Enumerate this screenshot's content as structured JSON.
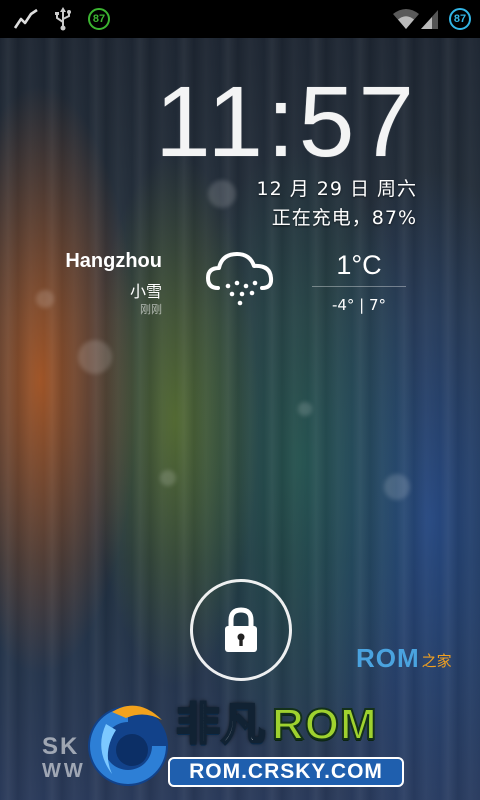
{
  "status_bar": {
    "left_icons": [
      "activity-graph-icon",
      "usb-icon",
      "battery-ring-icon"
    ],
    "left_battery_level": "87",
    "right_icons": [
      "wifi-icon",
      "signal-icon",
      "battery-ring-icon"
    ],
    "right_battery_level": "87",
    "colors": {
      "left_battery": "#3cb531",
      "right_battery": "#33b5e5"
    }
  },
  "lockscreen": {
    "time": "11:57",
    "date": "12 月 29 日 周六",
    "charging": "正在充电，87%"
  },
  "weather": {
    "city": "Hangzhou",
    "condition": "小雪",
    "updated": "刚刚",
    "icon": "snow-cloud-icon",
    "temperature": "1°C",
    "range": "-4° | 7°"
  },
  "unlock": {
    "icon": "lock-icon"
  },
  "watermarks": {
    "rom_small_big": "ROM",
    "rom_small_cn": "之家",
    "site_cn": "非凡",
    "site_rom": "ROM",
    "site_url": "ROM.CRSKY.COM",
    "left_partial_1": "SK",
    "left_partial_2": "WW"
  }
}
